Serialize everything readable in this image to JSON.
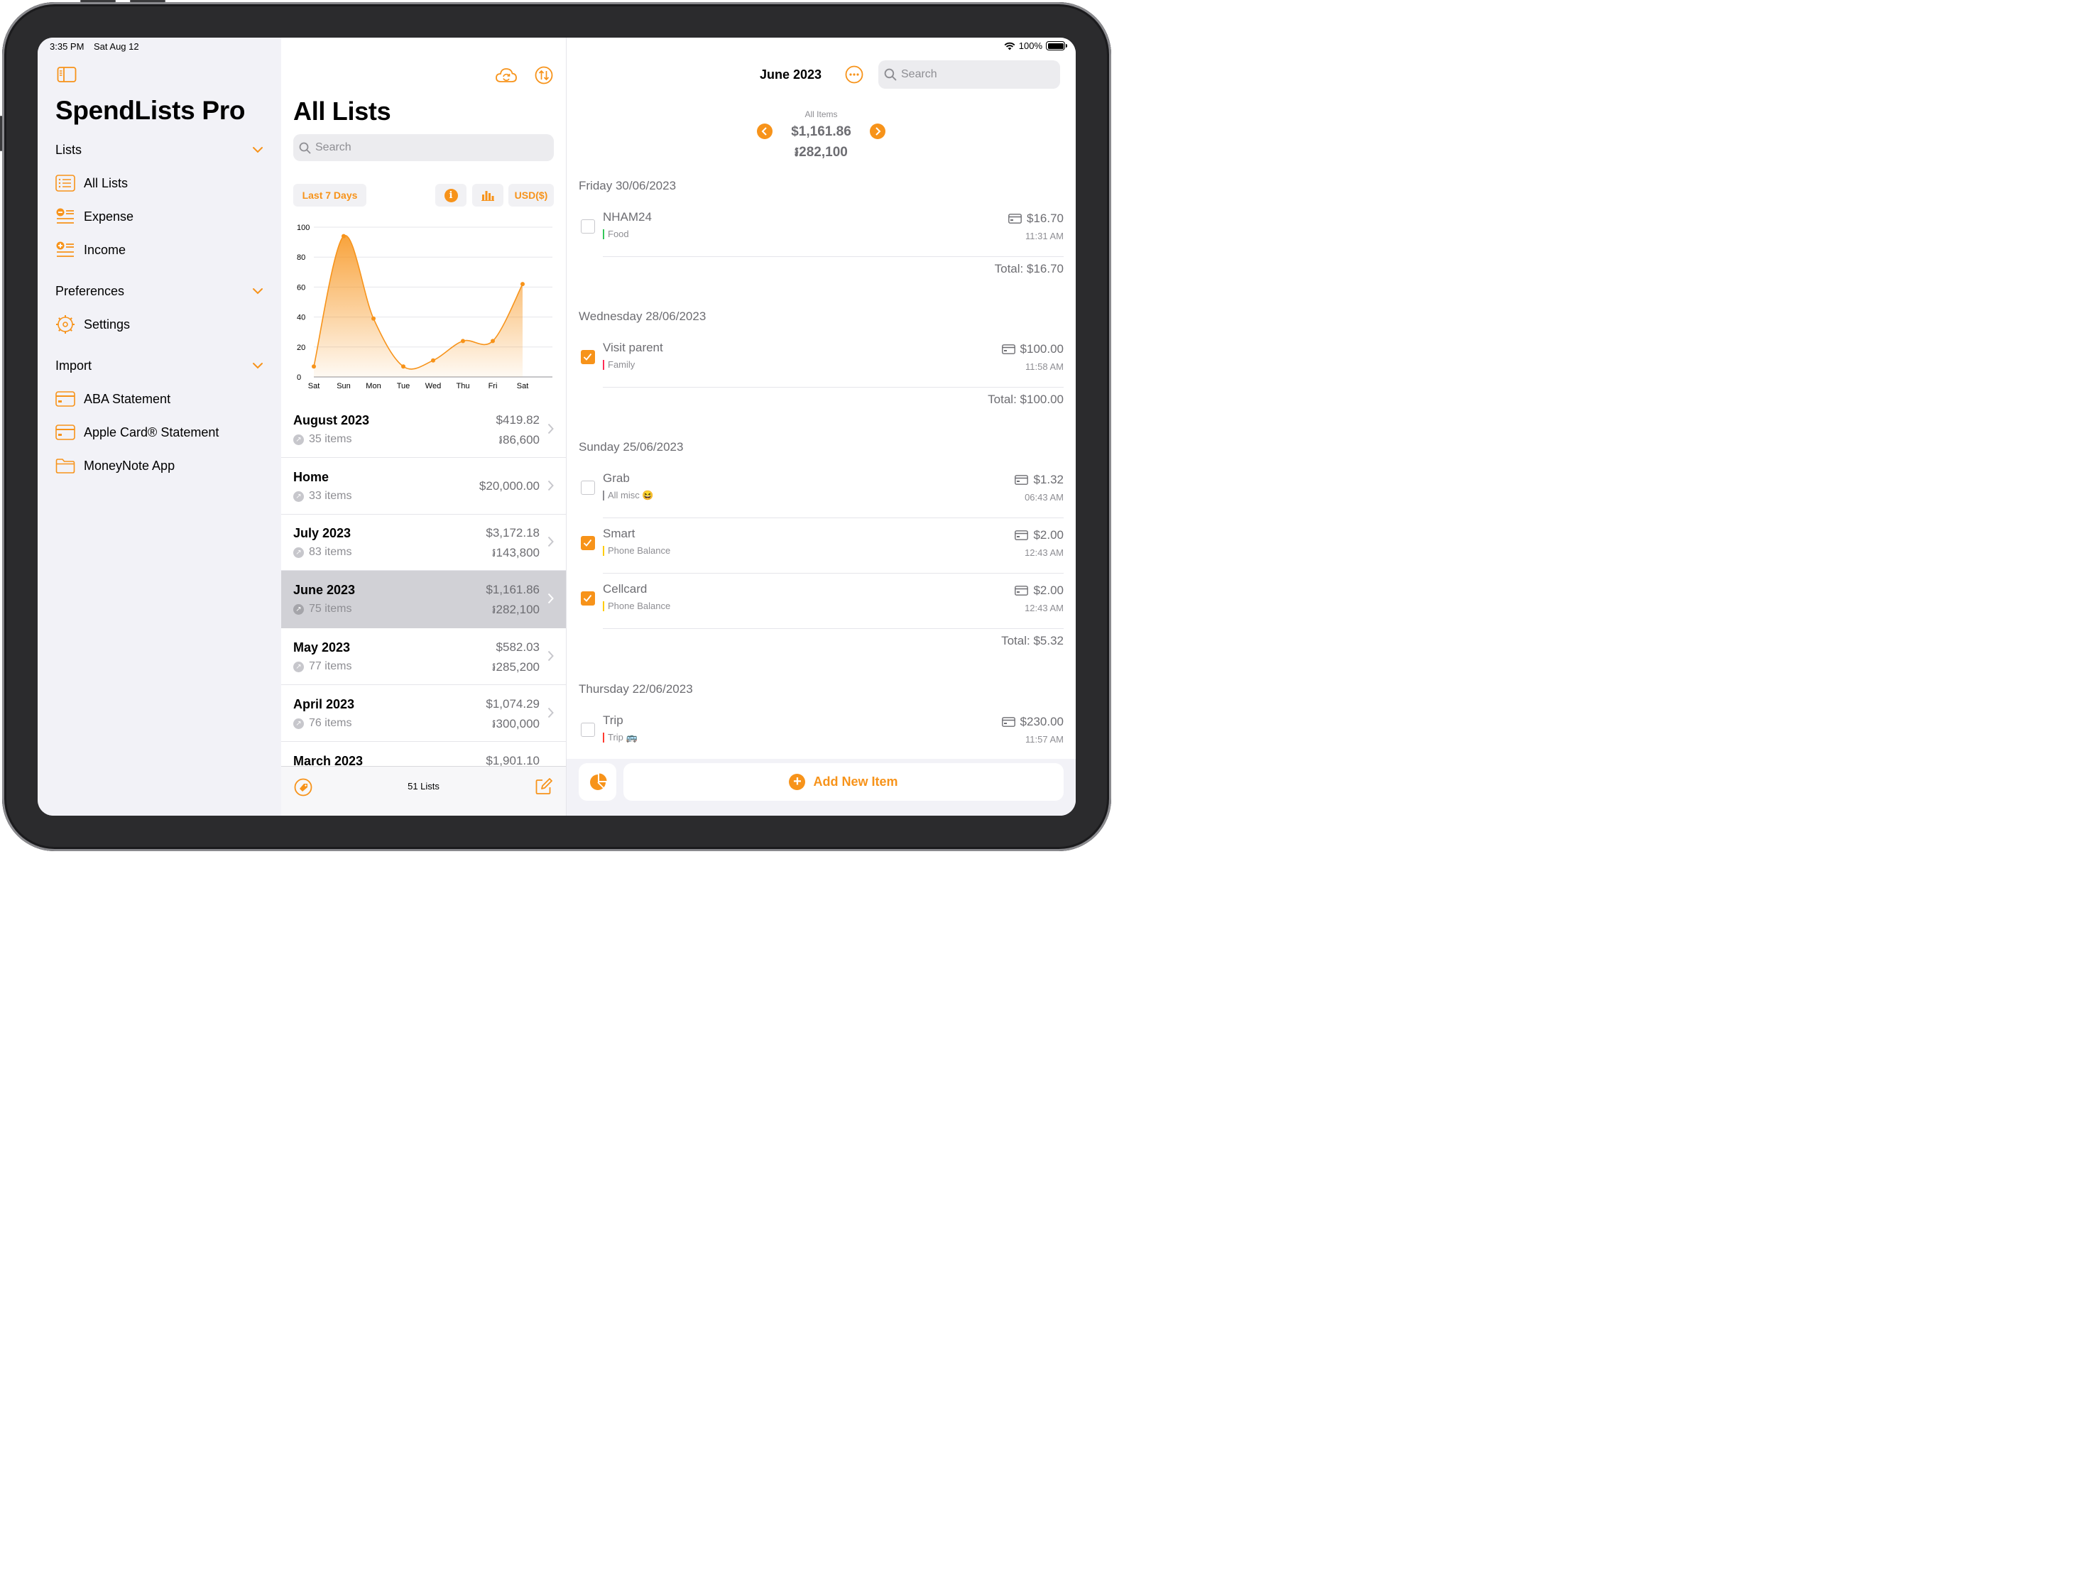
{
  "colors": {
    "accent": "#f7931a",
    "selected_row": "#d1d1d6",
    "sidebar_bg": "#f2f2f7"
  },
  "status_bar": {
    "time": "3:35 PM",
    "date": "Sat Aug 12",
    "battery": "100%"
  },
  "sidebar": {
    "title": "SpendLists Pro",
    "sections": [
      {
        "title": "Lists",
        "items": [
          {
            "label": "All Lists",
            "icon": "list-icon"
          },
          {
            "label": "Expense",
            "icon": "expense-icon"
          },
          {
            "label": "Income",
            "icon": "income-icon"
          }
        ]
      },
      {
        "title": "Preferences",
        "items": [
          {
            "label": "Settings",
            "icon": "gear-icon"
          }
        ]
      },
      {
        "title": "Import",
        "items": [
          {
            "label": "ABA Statement",
            "icon": "card-icon"
          },
          {
            "label": "Apple Card® Statement",
            "icon": "card-icon"
          },
          {
            "label": "MoneyNote App",
            "icon": "folder-icon"
          }
        ]
      }
    ]
  },
  "lists_panel": {
    "title": "All Lists",
    "search_placeholder": "Search",
    "filter_label": "Last 7 Days",
    "currency_label": "USD($)",
    "footer_count": "51 Lists",
    "lists": [
      {
        "name": "August 2023",
        "count": "35 items",
        "amount": "$419.82",
        "riel": "៛86,600"
      },
      {
        "name": "Home",
        "count": "33 items",
        "amount": "$20,000.00",
        "riel": ""
      },
      {
        "name": "July 2023",
        "count": "83 items",
        "amount": "$3,172.18",
        "riel": "៛143,800"
      },
      {
        "name": "June 2023",
        "count": "75 items",
        "amount": "$1,161.86",
        "riel": "៛282,100"
      },
      {
        "name": "May 2023",
        "count": "77 items",
        "amount": "$582.03",
        "riel": "៛285,200"
      },
      {
        "name": "April 2023",
        "count": "76 items",
        "amount": "$1,074.29",
        "riel": "៛300,000"
      },
      {
        "name": "March 2023",
        "count": "",
        "amount": "$1,901.10",
        "riel": ""
      }
    ]
  },
  "chart_data": {
    "type": "area",
    "categories": [
      "Sat",
      "Sun",
      "Mon",
      "Tue",
      "Wed",
      "Thu",
      "Fri",
      "Sat"
    ],
    "values": [
      7,
      94,
      39,
      7,
      11,
      24,
      24,
      62
    ],
    "ylim": [
      0,
      100
    ],
    "yticks": [
      0,
      20,
      40,
      60,
      80,
      100
    ],
    "grid": true,
    "color": "#f7931a"
  },
  "detail": {
    "title": "June 2023",
    "search_placeholder": "Search",
    "summary_label": "All Items",
    "summary_amount": "$1,161.86",
    "summary_riel": "៛282,100",
    "add_button": "Add New Item",
    "groups": [
      {
        "day": "Friday 30/06/2023",
        "total_label": "Total:",
        "total": "$16.70",
        "items": [
          {
            "name": "NHAM24",
            "category": "Food",
            "cat_color": "#34c759",
            "price": "$16.70",
            "time": "11:31 AM",
            "checked": false
          }
        ]
      },
      {
        "day": "Wednesday 28/06/2023",
        "total_label": "Total:",
        "total": "$100.00",
        "items": [
          {
            "name": "Visit parent",
            "category": "Family",
            "cat_color": "#ff2d55",
            "price": "$100.00",
            "time": "11:58 AM",
            "checked": true
          }
        ]
      },
      {
        "day": "Sunday 25/06/2023",
        "total_label": "Total:",
        "total": "$5.32",
        "items": [
          {
            "name": "Grab",
            "category": "All misc 😆",
            "cat_color": "#8e8e93",
            "price": "$1.32",
            "time": "06:43 AM",
            "checked": false
          },
          {
            "name": "Smart",
            "category": "Phone Balance",
            "cat_color": "#ffcc00",
            "price": "$2.00",
            "time": "12:43 AM",
            "checked": true
          },
          {
            "name": "Cellcard",
            "category": "Phone Balance",
            "cat_color": "#ffcc00",
            "price": "$2.00",
            "time": "12:43 AM",
            "checked": true
          }
        ]
      },
      {
        "day": "Thursday 22/06/2023",
        "total_label": "",
        "total": "",
        "items": [
          {
            "name": "Trip",
            "category": "Trip 🚌",
            "cat_color": "#ff3b30",
            "price": "$230.00",
            "time": "11:57 AM",
            "checked": false
          }
        ]
      }
    ]
  }
}
